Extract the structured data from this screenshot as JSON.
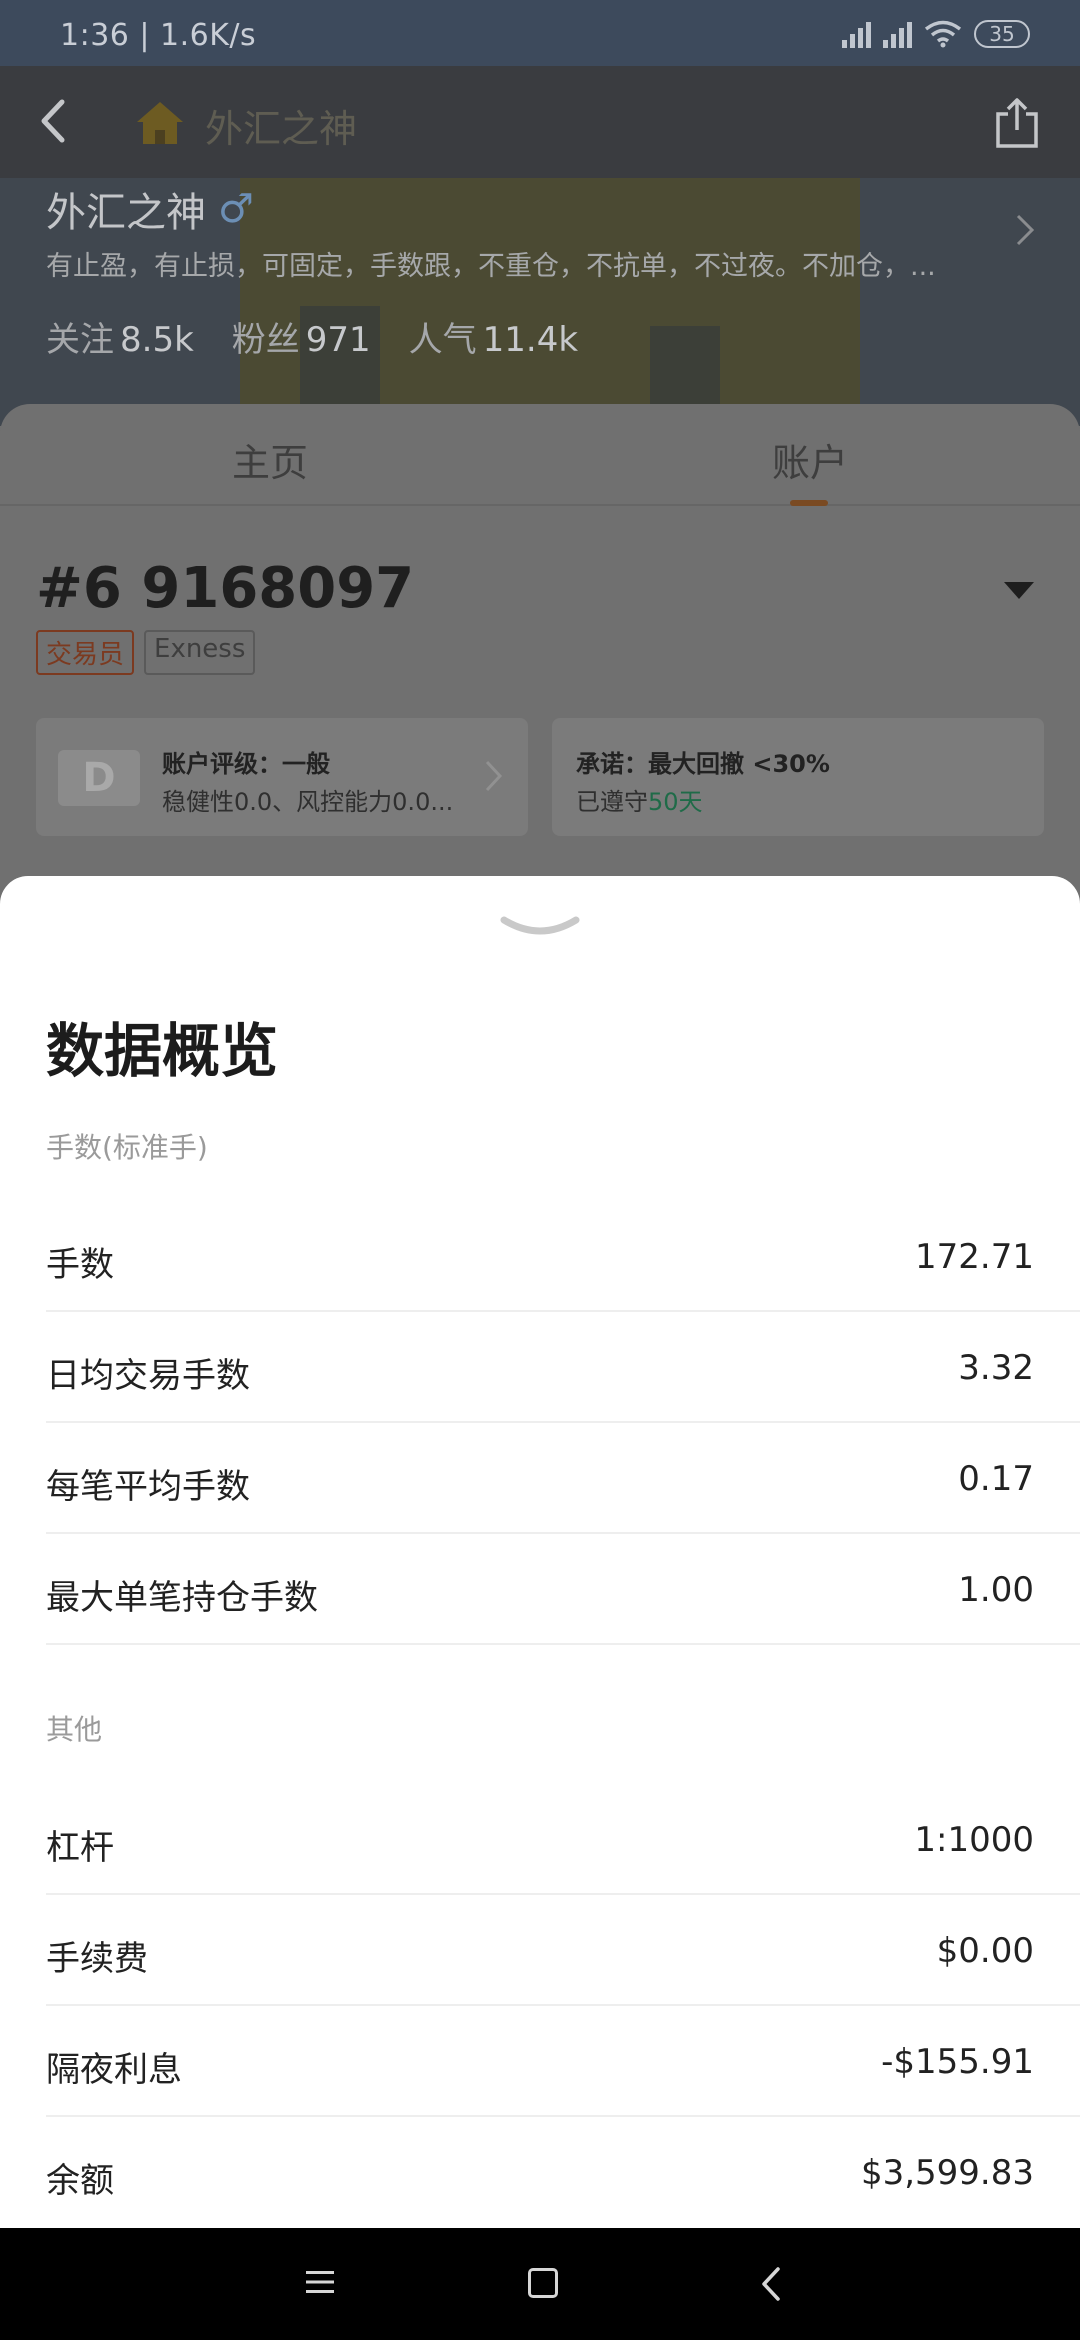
{
  "status_bar": {
    "time_speed": "1:36 | 1.6K/s",
    "battery": "35"
  },
  "header": {
    "title": "外汇之神",
    "icons": [
      "back-icon",
      "home-icon",
      "share-icon"
    ]
  },
  "profile": {
    "name": "外汇之神",
    "gender_symbol": "♂",
    "bio": "有止盈，有止损，可固定，手数跟，不重仓，不抗单，不过夜。不加仓，...",
    "stats": [
      {
        "label": "关注",
        "value": "8.5k"
      },
      {
        "label": "粉丝",
        "value": "971"
      },
      {
        "label": "人气",
        "value": "11.4k"
      }
    ]
  },
  "tabs": [
    {
      "label": "主页",
      "active": false
    },
    {
      "label": "账户",
      "active": true
    }
  ],
  "account": {
    "number": "#6 9168097",
    "tags": [
      "交易员",
      "Exness"
    ],
    "rating": {
      "grade": "D",
      "title": "账户评级：一般",
      "subtitle": "稳健性0.0、风控能力0.0..."
    },
    "promise": {
      "title": "承诺：最大回撤 <30%",
      "kept_prefix": "已遵守",
      "kept_days": "50天"
    }
  },
  "sheet": {
    "title": "数据概览",
    "sections": [
      {
        "label": "手数(标准手)",
        "rows": [
          {
            "label": "手数",
            "value": "172.71"
          },
          {
            "label": "日均交易手数",
            "value": "3.32"
          },
          {
            "label": "每笔平均手数",
            "value": "0.17"
          },
          {
            "label": "最大单笔持仓手数",
            "value": "1.00"
          }
        ]
      },
      {
        "label": "其他",
        "rows": [
          {
            "label": "杠杆",
            "value": "1:1000"
          },
          {
            "label": "手续费",
            "value": "$0.00"
          },
          {
            "label": "隔夜利息",
            "value": "-$155.91"
          },
          {
            "label": "余额",
            "value": "$3,599.83"
          }
        ]
      }
    ]
  },
  "colors": {
    "accent": "#e87a2e",
    "positive": "#2bb574",
    "trader_tag": "#e0603a"
  }
}
